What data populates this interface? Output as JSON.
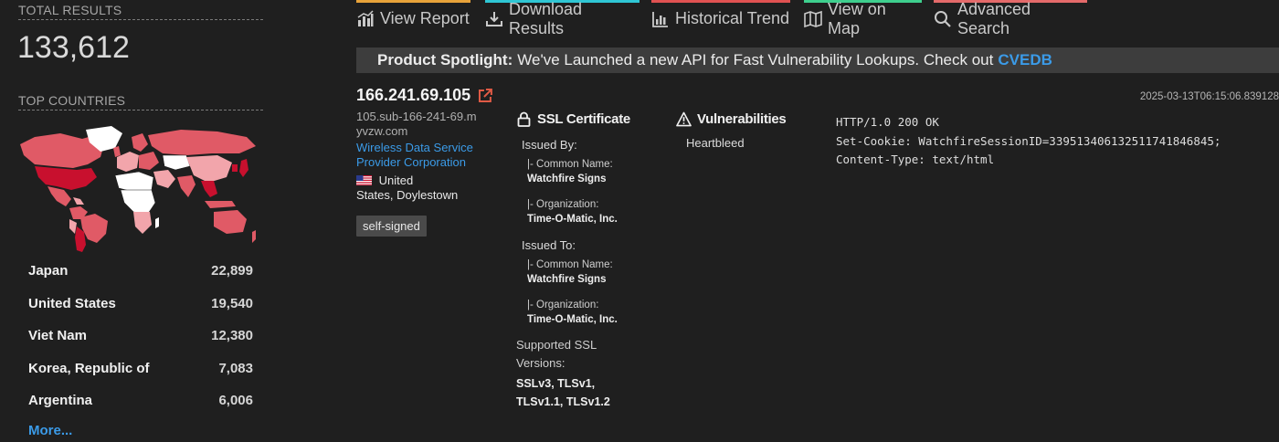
{
  "sidebar": {
    "total_results_label": "TOTAL RESULTS",
    "total_results": "133,612",
    "top_countries_label": "TOP COUNTRIES",
    "countries": [
      {
        "name": "Japan",
        "count": "22,899"
      },
      {
        "name": "United States",
        "count": "19,540"
      },
      {
        "name": "Viet Nam",
        "count": "12,380"
      },
      {
        "name": "Korea, Republic of",
        "count": "7,083"
      },
      {
        "name": "Argentina",
        "count": "6,006"
      }
    ],
    "more_label": "More..."
  },
  "nav": [
    {
      "label": "View Report",
      "icon": "bar-chart-icon",
      "accent": "#e8a33a"
    },
    {
      "label": "Download Results",
      "icon": "download-icon",
      "accent": "#2fc6d4"
    },
    {
      "label": "Historical Trend",
      "icon": "line-chart-icon",
      "accent": "#e05252"
    },
    {
      "label": "View on Map",
      "icon": "map-icon",
      "accent": "#3ecf8e"
    },
    {
      "label": "Advanced Search",
      "icon": "search-icon",
      "accent": "#e46a6a"
    }
  ],
  "banner": {
    "prefix": "Product Spotlight:",
    "text": "We've Launched a new API for Fast Vulnerability Lookups. Check out",
    "link": "CVEDB"
  },
  "result": {
    "ip": "166.241.69.105",
    "hostname": "105.sub-166-241-69.myvzw.com",
    "org": "Wireless Data Service Provider Corporation",
    "location_country": "United",
    "location_rest": "States, Doylestown",
    "tag": "self-signed",
    "timestamp": "2025-03-13T06:15:06.839128",
    "ssl": {
      "title": "SSL Certificate",
      "issued_by_label": "Issued By:",
      "issued_to_label": "Issued To:",
      "common_name_label": "|- Common Name:",
      "organization_label": "|- Organization:",
      "issued_by_cn": "Watchfire Signs",
      "issued_by_org": "Time-O-Matic, Inc.",
      "issued_to_cn": "Watchfire Signs",
      "issued_to_org": "Time-O-Matic, Inc.",
      "supported_label": "Supported SSL Versions:",
      "versions": "SSLv3, TLSv1, TLSv1.1, TLSv1.2"
    },
    "vulns": {
      "title": "Vulnerabilities",
      "items": [
        "Heartbleed"
      ]
    },
    "banner_lines": [
      "HTTP/1.0 200 OK",
      "Set-Cookie: WatchfireSessionID=339513406132511741846845;",
      "Content-Type: text/html"
    ]
  },
  "colors": {
    "link": "#3b9be8",
    "map_dark": "#c8102e",
    "map_mid": "#e05a66",
    "map_light": "#f2a5ab"
  }
}
